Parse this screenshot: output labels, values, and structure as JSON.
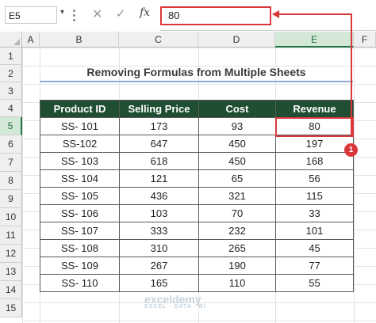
{
  "formula_bar": {
    "name_box": "E5",
    "cancel_icon": "close-icon",
    "enter_icon": "check-icon",
    "fx_label": "fx",
    "formula_value": "80"
  },
  "columns": [
    "A",
    "B",
    "C",
    "D",
    "E",
    "F"
  ],
  "rows": [
    "1",
    "2",
    "3",
    "4",
    "5",
    "6",
    "7",
    "8",
    "9",
    "10",
    "11",
    "12",
    "13",
    "14",
    "15"
  ],
  "sheet": {
    "title": "Removing Formulas from Multiple Sheets",
    "headers": [
      "Product ID",
      "Selling Price",
      "Cost",
      "Revenue"
    ],
    "data": [
      [
        "SS- 101",
        "173",
        "93",
        "80"
      ],
      [
        "SS-102",
        "647",
        "450",
        "197"
      ],
      [
        "SS- 103",
        "618",
        "450",
        "168"
      ],
      [
        "SS- 104",
        "121",
        "65",
        "56"
      ],
      [
        "SS- 105",
        "436",
        "321",
        "115"
      ],
      [
        "SS- 106",
        "103",
        "70",
        "33"
      ],
      [
        "SS- 107",
        "333",
        "232",
        "101"
      ],
      [
        "SS- 108",
        "310",
        "265",
        "45"
      ],
      [
        "SS- 109",
        "267",
        "190",
        "77"
      ],
      [
        "SS- 110",
        "165",
        "110",
        "55"
      ]
    ]
  },
  "annotation": {
    "badge": "1",
    "accent": "#d9383b"
  },
  "watermark": {
    "brand": "exceldemy",
    "tagline": "EXCEL · DATA · BI"
  },
  "colors": {
    "header_fill": "#1f4e33",
    "selected_header": "#217346",
    "title_underline": "#8eaadb"
  }
}
